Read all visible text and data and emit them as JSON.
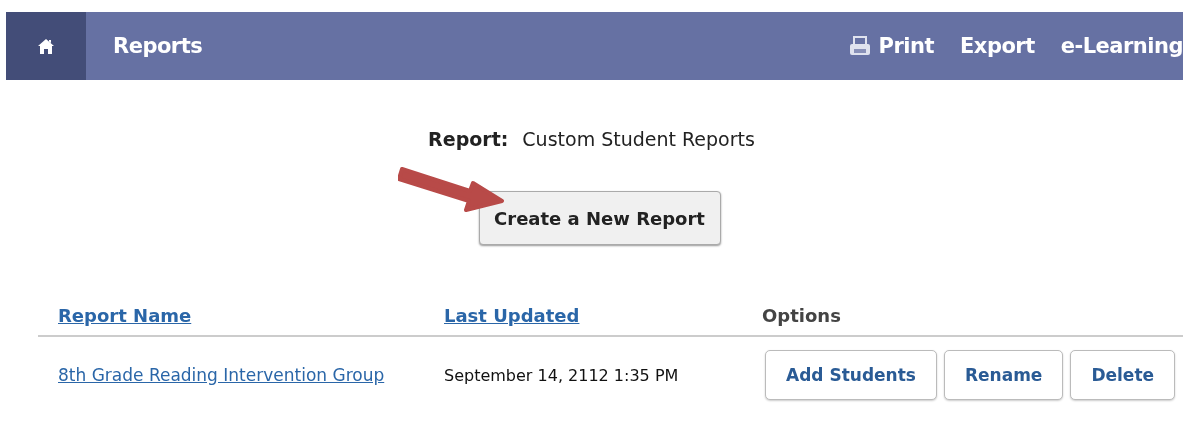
{
  "nav": {
    "title": "Reports",
    "links": [
      {
        "label": "Print",
        "kind": "print"
      },
      {
        "label": "Export",
        "kind": "plain"
      },
      {
        "label": "e-Learning",
        "kind": "plain"
      }
    ]
  },
  "report": {
    "label": "Report:",
    "value": "Custom Student Reports"
  },
  "create_button": "Create a New Report",
  "table": {
    "columns": [
      {
        "label": "Report Name",
        "kind": "link"
      },
      {
        "label": "Last Updated",
        "kind": "link"
      },
      {
        "label": "Options",
        "kind": "plain"
      }
    ],
    "rows": [
      {
        "name": "8th Grade Reading Intervention Group",
        "updated": "September 14, 2112 1:35 PM",
        "actions": [
          "Add Students",
          "Rename",
          "Delete"
        ]
      }
    ]
  }
}
